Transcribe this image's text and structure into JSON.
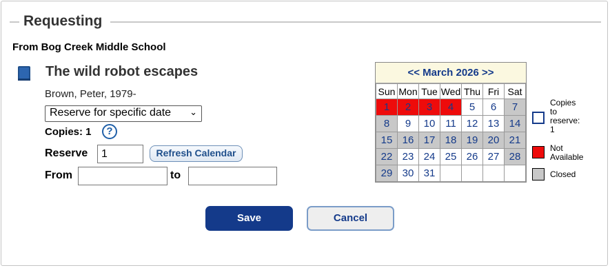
{
  "section": {
    "title": "Requesting"
  },
  "from_school": "From Bog Creek Middle School",
  "item": {
    "icon": "book-icon",
    "title": "The wild robot escapes",
    "author": "Brown, Peter, 1979-"
  },
  "request_type": {
    "selected": "Reserve for specific date"
  },
  "copies": {
    "label": "Copies: 1",
    "help_icon": "question-icon",
    "help_text": "?"
  },
  "reserve": {
    "label": "Reserve",
    "value": "1",
    "refresh_label": "Refresh Calendar"
  },
  "date_range": {
    "from_label": "From",
    "to_label": "to",
    "from_value": "",
    "to_value": ""
  },
  "actions": {
    "save_label": "Save",
    "cancel_label": "Cancel"
  },
  "calendar": {
    "prev_label": "<<",
    "month_label": "March 2026",
    "next_label": ">>",
    "weekdays": [
      "Sun",
      "Mon",
      "Tue",
      "Wed",
      "Thu",
      "Fri",
      "Sat"
    ],
    "weeks": [
      [
        {
          "d": "1",
          "s": "na"
        },
        {
          "d": "2",
          "s": "na"
        },
        {
          "d": "3",
          "s": "na"
        },
        {
          "d": "4",
          "s": "na"
        },
        {
          "d": "5",
          "s": "open"
        },
        {
          "d": "6",
          "s": "open"
        },
        {
          "d": "7",
          "s": "closed"
        }
      ],
      [
        {
          "d": "8",
          "s": "closed"
        },
        {
          "d": "9",
          "s": "open"
        },
        {
          "d": "10",
          "s": "open"
        },
        {
          "d": "11",
          "s": "open"
        },
        {
          "d": "12",
          "s": "open"
        },
        {
          "d": "13",
          "s": "open"
        },
        {
          "d": "14",
          "s": "closed"
        }
      ],
      [
        {
          "d": "15",
          "s": "closed"
        },
        {
          "d": "16",
          "s": "closed"
        },
        {
          "d": "17",
          "s": "closed"
        },
        {
          "d": "18",
          "s": "closed"
        },
        {
          "d": "19",
          "s": "closed"
        },
        {
          "d": "20",
          "s": "closed"
        },
        {
          "d": "21",
          "s": "closed"
        }
      ],
      [
        {
          "d": "22",
          "s": "closed"
        },
        {
          "d": "23",
          "s": "open"
        },
        {
          "d": "24",
          "s": "open"
        },
        {
          "d": "25",
          "s": "open"
        },
        {
          "d": "26",
          "s": "open"
        },
        {
          "d": "27",
          "s": "open"
        },
        {
          "d": "28",
          "s": "closed"
        }
      ],
      [
        {
          "d": "29",
          "s": "closed"
        },
        {
          "d": "30",
          "s": "open"
        },
        {
          "d": "31",
          "s": "open"
        },
        {
          "d": "",
          "s": "empty"
        },
        {
          "d": "",
          "s": "empty"
        },
        {
          "d": "",
          "s": "empty"
        },
        {
          "d": "",
          "s": "empty"
        }
      ]
    ]
  },
  "legend": {
    "copies_to_reserve": "Copies to reserve: 1",
    "not_available": "Not Available",
    "closed": "Closed"
  },
  "colors": {
    "primary": "#143a8a",
    "not_available": "#ee0b0b",
    "closed": "#c8c8c8",
    "calendar_header": "#fbf8e0"
  }
}
